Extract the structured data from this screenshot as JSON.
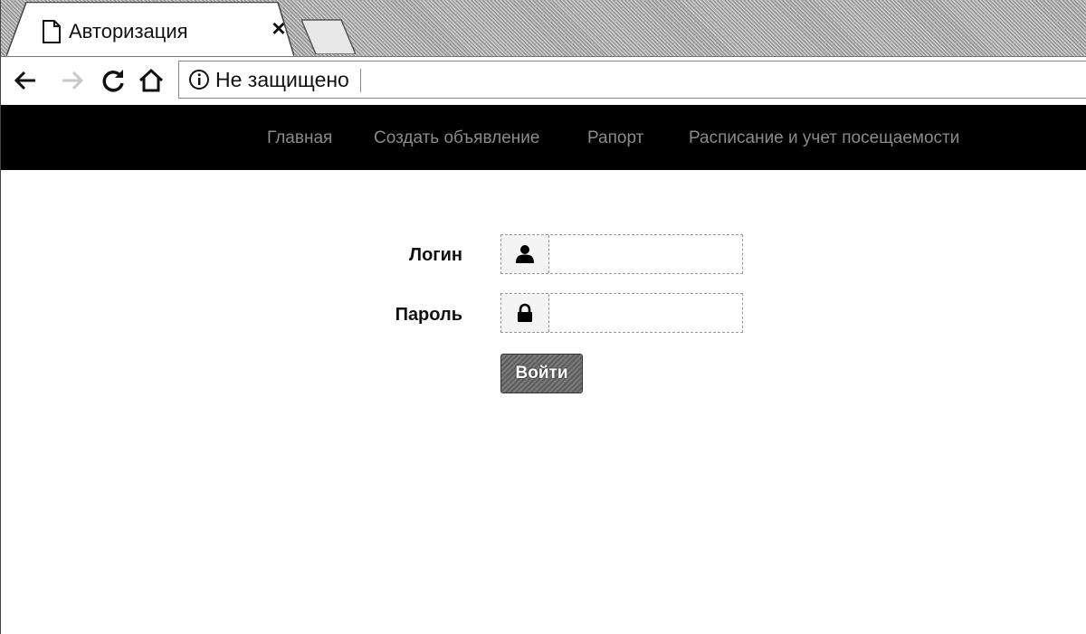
{
  "browser": {
    "tab": {
      "title": "Авторизация",
      "close_glyph": "×",
      "page_icon": "page-icon"
    },
    "toolbar": {
      "back_icon": "arrow-left-icon",
      "forward_icon": "arrow-right-icon",
      "reload_icon": "reload-icon",
      "home_icon": "home-icon",
      "security_icon": "info-icon",
      "security_label": "Не защищено",
      "url": ""
    }
  },
  "site_nav": {
    "items": [
      {
        "label": "Главная"
      },
      {
        "label": "Создать объявление"
      },
      {
        "label": "Рапорт"
      },
      {
        "label": "Расписание и учет посещаемости"
      }
    ]
  },
  "login_form": {
    "login_label": "Логин",
    "login_icon": "user-icon",
    "login_value": "",
    "password_label": "Пароль",
    "password_icon": "lock-icon",
    "password_value": "",
    "submit_label": "Войти"
  },
  "colors": {
    "nav_background": "#000000",
    "nav_text": "#8a8a8a",
    "button_background": "#6a6a6a",
    "button_text": "#ffffff"
  }
}
